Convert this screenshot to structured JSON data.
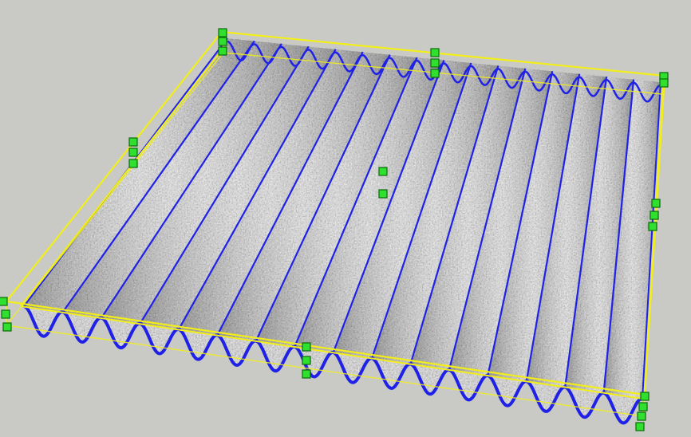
{
  "viewport": {
    "background": "#c9cac6",
    "selected": true
  },
  "model": {
    "object": "corrugated-sheet",
    "corrugation_count": 16,
    "material": "gray-speckled-texture",
    "selection_box_color": "#f2ee1a",
    "edge_color": "#1f22e6",
    "grip_color": "#2fe02f",
    "grip_border_color": "#0a6a0a"
  }
}
